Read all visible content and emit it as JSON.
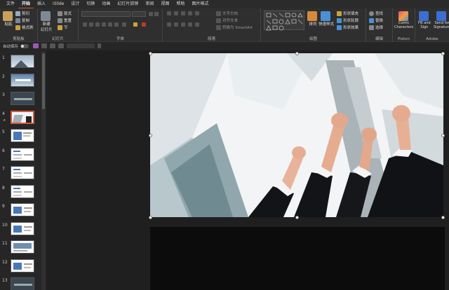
{
  "menu": {
    "tabs": [
      "文件",
      "开始",
      "插入",
      "iSlide",
      "设计",
      "切换",
      "动画",
      "幻灯片放映",
      "审阅",
      "视图",
      "帮助",
      "图片格式"
    ],
    "active_index": 1
  },
  "ribbon": {
    "clipboard": {
      "paste": "粘贴",
      "cut": "剪切",
      "copy": "复制",
      "format_painter": "格式刷",
      "label": "剪贴板"
    },
    "slides": {
      "new_slide": "新建\n幻灯片",
      "layout": "版式",
      "reset": "重置",
      "section": "节",
      "label": "幻灯片"
    },
    "font": {
      "label": "字体"
    },
    "paragraph": {
      "text_direction": "文字方向",
      "align_text": "对齐文本",
      "smartart": "转换为 SmartArt",
      "label": "段落"
    },
    "drawing": {
      "arrange": "排列",
      "quick_styles": "快速样式",
      "shape_fill": "形状填充",
      "shape_outline": "形状轮廓",
      "shape_effects": "形状效果",
      "label": "绘图"
    },
    "editing": {
      "find": "查找",
      "replace": "替换",
      "select": "选择",
      "label": "编辑"
    },
    "pixton": {
      "comic": "Comic\nCharacters",
      "label": "Pixton"
    },
    "adobe": {
      "fill_sign": "Fill and\nSign",
      "send_signature": "Send for\nSignature",
      "label": "Adobe"
    }
  },
  "qat": {
    "autosave": "自动保存"
  },
  "slides": [
    {
      "num": "1",
      "star": false,
      "theme": "mountain"
    },
    {
      "num": "2",
      "star": false,
      "theme": "sky"
    },
    {
      "num": "3",
      "star": false,
      "theme": "dark"
    },
    {
      "num": "4",
      "star": true,
      "theme": "building",
      "selected": true
    },
    {
      "num": "5",
      "star": false,
      "theme": "doc"
    },
    {
      "num": "6",
      "star": false,
      "theme": "text"
    },
    {
      "num": "7",
      "star": false,
      "theme": "text"
    },
    {
      "num": "8",
      "star": false,
      "theme": "text"
    },
    {
      "num": "9",
      "star": false,
      "theme": "blue-doc"
    },
    {
      "num": "10",
      "star": false,
      "theme": "blue-doc"
    },
    {
      "num": "11",
      "star": false,
      "theme": "photo-doc"
    },
    {
      "num": "12",
      "star": false,
      "theme": "blue-doc"
    },
    {
      "num": "13",
      "star": false,
      "theme": "dark"
    }
  ],
  "colors": {
    "accent": "#d2583a",
    "ribbon_bg": "#2f2f2f",
    "pane_bg": "#262626"
  }
}
